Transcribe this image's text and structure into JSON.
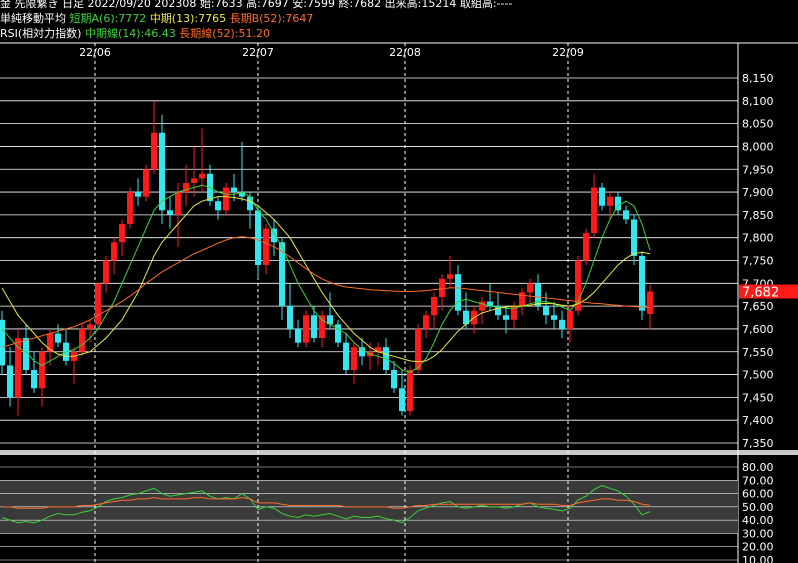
{
  "header": {
    "line1": "金 先限繋き 日足 2022/09/20 202308 始:7633 高:7697 安:7599 終:7682 出来高:15214 取組高:----",
    "line2": {
      "label": "単純移動平均",
      "short": "短期A(6):7772",
      "mid": "中期(13):7765",
      "long": "長期B(52):7647"
    },
    "line3": {
      "label": "RSI(相対力指数)",
      "mid": "中期線(14):46.43",
      "long": "長期線(52):51.20"
    }
  },
  "colors": {
    "up": "#ff1a1a",
    "down": "#33e6f0",
    "ma_short": "#39d239",
    "ma_mid": "#e8e840",
    "ma_long": "#ff6a2a",
    "last_price_bg": "#ff1a1a",
    "grid": "#ffffff"
  },
  "chart_data": [
    {
      "type": "candlestick",
      "x_labels": [
        "22/06",
        "22/07",
        "22/08",
        "22/09"
      ],
      "ylim": [
        7330,
        8170
      ],
      "y_ticks": [
        "8,150",
        "8,100",
        "8,050",
        "8,000",
        "7,950",
        "7,900",
        "7,850",
        "7,800",
        "7,750",
        "7,700",
        "7,650",
        "7,600",
        "7,550",
        "7,500",
        "7,450",
        "7,400",
        "7,350"
      ],
      "last_price": "7,682",
      "candles": [
        [
          7620,
          7640,
          7500,
          7520
        ],
        [
          7520,
          7560,
          7430,
          7450
        ],
        [
          7450,
          7600,
          7410,
          7580
        ],
        [
          7580,
          7610,
          7500,
          7510
        ],
        [
          7510,
          7550,
          7460,
          7470
        ],
        [
          7470,
          7560,
          7430,
          7550
        ],
        [
          7550,
          7600,
          7520,
          7590
        ],
        [
          7590,
          7610,
          7560,
          7570
        ],
        [
          7570,
          7600,
          7520,
          7530
        ],
        [
          7530,
          7560,
          7480,
          7550
        ],
        [
          7550,
          7610,
          7540,
          7600
        ],
        [
          7600,
          7620,
          7570,
          7610
        ],
        [
          7610,
          7700,
          7600,
          7700
        ],
        [
          7700,
          7760,
          7680,
          7750
        ],
        [
          7750,
          7800,
          7720,
          7790
        ],
        [
          7790,
          7840,
          7760,
          7830
        ],
        [
          7830,
          7910,
          7820,
          7900
        ],
        [
          7900,
          7930,
          7870,
          7890
        ],
        [
          7890,
          7960,
          7880,
          7950
        ],
        [
          7950,
          8100,
          7940,
          8030
        ],
        [
          8030,
          8070,
          7830,
          7860
        ],
        [
          7860,
          7890,
          7820,
          7850
        ],
        [
          7850,
          7920,
          7780,
          7900
        ],
        [
          7900,
          7960,
          7870,
          7920
        ],
        [
          7920,
          8000,
          7890,
          7930
        ],
        [
          7930,
          8040,
          7900,
          7940
        ],
        [
          7940,
          7960,
          7870,
          7880
        ],
        [
          7880,
          7890,
          7840,
          7860
        ],
        [
          7860,
          7920,
          7850,
          7910
        ],
        [
          7910,
          7940,
          7880,
          7900
        ],
        [
          7900,
          8010,
          7880,
          7890
        ],
        [
          7890,
          7900,
          7820,
          7860
        ],
        [
          7860,
          7870,
          7710,
          7740
        ],
        [
          7740,
          7830,
          7720,
          7820
        ],
        [
          7820,
          7840,
          7760,
          7790
        ],
        [
          7790,
          7800,
          7620,
          7650
        ],
        [
          7650,
          7700,
          7580,
          7600
        ],
        [
          7600,
          7620,
          7560,
          7570
        ],
        [
          7570,
          7640,
          7560,
          7630
        ],
        [
          7630,
          7650,
          7570,
          7580
        ],
        [
          7580,
          7640,
          7560,
          7630
        ],
        [
          7630,
          7680,
          7600,
          7610
        ],
        [
          7610,
          7620,
          7560,
          7570
        ],
        [
          7570,
          7590,
          7500,
          7510
        ],
        [
          7510,
          7570,
          7480,
          7560
        ],
        [
          7560,
          7580,
          7520,
          7540
        ],
        [
          7540,
          7570,
          7510,
          7550
        ],
        [
          7550,
          7570,
          7520,
          7560
        ],
        [
          7560,
          7580,
          7500,
          7510
        ],
        [
          7510,
          7530,
          7460,
          7470
        ],
        [
          7470,
          7510,
          7410,
          7420
        ],
        [
          7420,
          7520,
          7410,
          7510
        ],
        [
          7510,
          7610,
          7500,
          7600
        ],
        [
          7600,
          7640,
          7580,
          7630
        ],
        [
          7630,
          7680,
          7600,
          7670
        ],
        [
          7670,
          7720,
          7640,
          7710
        ],
        [
          7710,
          7760,
          7690,
          7720
        ],
        [
          7720,
          7740,
          7630,
          7640
        ],
        [
          7640,
          7680,
          7600,
          7610
        ],
        [
          7610,
          7650,
          7590,
          7640
        ],
        [
          7640,
          7670,
          7610,
          7660
        ],
        [
          7660,
          7700,
          7640,
          7650
        ],
        [
          7650,
          7680,
          7620,
          7630
        ],
        [
          7630,
          7650,
          7590,
          7620
        ],
        [
          7620,
          7660,
          7600,
          7650
        ],
        [
          7650,
          7690,
          7630,
          7680
        ],
        [
          7680,
          7710,
          7650,
          7700
        ],
        [
          7700,
          7720,
          7640,
          7650
        ],
        [
          7650,
          7680,
          7610,
          7630
        ],
        [
          7630,
          7660,
          7600,
          7620
        ],
        [
          7620,
          7640,
          7580,
          7600
        ],
        [
          7600,
          7650,
          7570,
          7640
        ],
        [
          7640,
          7760,
          7630,
          7750
        ],
        [
          7750,
          7820,
          7740,
          7810
        ],
        [
          7810,
          7940,
          7800,
          7910
        ],
        [
          7910,
          7920,
          7860,
          7870
        ],
        [
          7870,
          7900,
          7840,
          7890
        ],
        [
          7890,
          7900,
          7850,
          7860
        ],
        [
          7860,
          7870,
          7830,
          7840
        ],
        [
          7840,
          7850,
          7740,
          7760
        ],
        [
          7760,
          7770,
          7620,
          7640
        ],
        [
          7633,
          7697,
          7599,
          7682
        ]
      ],
      "series": [
        {
          "name": "短期A(6)",
          "values": [
            7600,
            7580,
            7560,
            7550,
            7530,
            7520,
            7530,
            7540,
            7550,
            7555,
            7565,
            7580,
            7600,
            7630,
            7660,
            7700,
            7740,
            7780,
            7820,
            7860,
            7880,
            7890,
            7900,
            7905,
            7910,
            7915,
            7910,
            7900,
            7895,
            7895,
            7900,
            7890,
            7860,
            7840,
            7810,
            7780,
            7740,
            7700,
            7670,
            7640,
            7620,
            7610,
            7600,
            7590,
            7570,
            7555,
            7545,
            7540,
            7535,
            7525,
            7510,
            7505,
            7515,
            7535,
            7570,
            7610,
            7640,
            7660,
            7665,
            7660,
            7655,
            7650,
            7648,
            7645,
            7645,
            7650,
            7655,
            7660,
            7660,
            7655,
            7648,
            7640,
            7660,
            7700,
            7750,
            7800,
            7840,
            7870,
            7880,
            7870,
            7830,
            7772
          ]
        },
        {
          "name": "中期(13)",
          "values": [
            7690,
            7660,
            7630,
            7610,
            7590,
            7570,
            7555,
            7545,
            7540,
            7540,
            7545,
            7550,
            7565,
            7580,
            7600,
            7620,
            7650,
            7680,
            7720,
            7760,
            7790,
            7810,
            7830,
            7850,
            7870,
            7880,
            7885,
            7890,
            7890,
            7888,
            7885,
            7880,
            7870,
            7855,
            7840,
            7820,
            7800,
            7770,
            7740,
            7710,
            7680,
            7655,
            7630,
            7610,
            7590,
            7575,
            7560,
            7550,
            7545,
            7540,
            7535,
            7530,
            7528,
            7530,
            7540,
            7555,
            7575,
            7595,
            7610,
            7625,
            7635,
            7640,
            7645,
            7648,
            7650,
            7650,
            7652,
            7655,
            7656,
            7655,
            7652,
            7650,
            7655,
            7665,
            7680,
            7700,
            7720,
            7740,
            7755,
            7765,
            7768,
            7765
          ]
        },
        {
          "name": "長期B(52)",
          "values": [
            7560,
            7565,
            7570,
            7575,
            7580,
            7585,
            7590,
            7595,
            7600,
            7605,
            7612,
            7620,
            7630,
            7640,
            7650,
            7660,
            7672,
            7685,
            7700,
            7712,
            7725,
            7735,
            7745,
            7755,
            7765,
            7772,
            7780,
            7788,
            7795,
            7800,
            7802,
            7800,
            7795,
            7788,
            7780,
            7770,
            7758,
            7745,
            7732,
            7720,
            7710,
            7702,
            7696,
            7692,
            7690,
            7688,
            7686,
            7685,
            7684,
            7683,
            7682,
            7682,
            7683,
            7684,
            7686,
            7688,
            7690,
            7690,
            7688,
            7686,
            7684,
            7682,
            7680,
            7678,
            7676,
            7674,
            7672,
            7670,
            7668,
            7666,
            7664,
            7662,
            7660,
            7658,
            7656,
            7655,
            7653,
            7652,
            7650,
            7649,
            7648,
            7647
          ]
        }
      ]
    },
    {
      "type": "line",
      "ylim": [
        10,
        80
      ],
      "y_ticks": [
        "80.00",
        "70.00",
        "60.00",
        "50.00",
        "40.00",
        "30.00",
        "20.00",
        "10.00"
      ],
      "series": [
        {
          "name": "中期線(14)",
          "values": [
            42,
            40,
            38,
            39,
            38,
            40,
            43,
            45,
            44,
            44,
            46,
            47,
            50,
            54,
            56,
            57,
            59,
            60,
            62,
            64,
            60,
            58,
            59,
            60,
            61,
            62,
            58,
            56,
            57,
            56,
            60,
            56,
            48,
            50,
            49,
            45,
            43,
            42,
            44,
            43,
            44,
            45,
            43,
            41,
            43,
            42,
            42,
            43,
            41,
            40,
            38,
            42,
            47,
            49,
            51,
            53,
            54,
            50,
            49,
            50,
            51,
            50,
            50,
            49,
            50,
            52,
            53,
            50,
            49,
            48,
            47,
            49,
            55,
            58,
            63,
            66,
            64,
            62,
            58,
            52,
            44,
            46.43
          ]
        },
        {
          "name": "長期線(52)",
          "values": [
            50,
            50,
            49,
            49,
            49,
            49,
            50,
            50,
            50,
            50,
            51,
            51,
            52,
            53,
            54,
            55,
            55,
            56,
            56,
            57,
            56,
            56,
            56,
            56,
            57,
            57,
            56,
            56,
            56,
            56,
            57,
            56,
            53,
            53,
            53,
            52,
            51,
            51,
            51,
            51,
            51,
            51,
            51,
            50,
            50,
            50,
            50,
            50,
            50,
            49,
            49,
            50,
            51,
            51,
            52,
            52,
            52,
            52,
            52,
            52,
            52,
            52,
            52,
            52,
            52,
            52,
            53,
            52,
            52,
            52,
            51,
            51,
            53,
            54,
            55,
            56,
            56,
            55,
            55,
            54,
            52,
            51.2
          ]
        }
      ]
    }
  ]
}
